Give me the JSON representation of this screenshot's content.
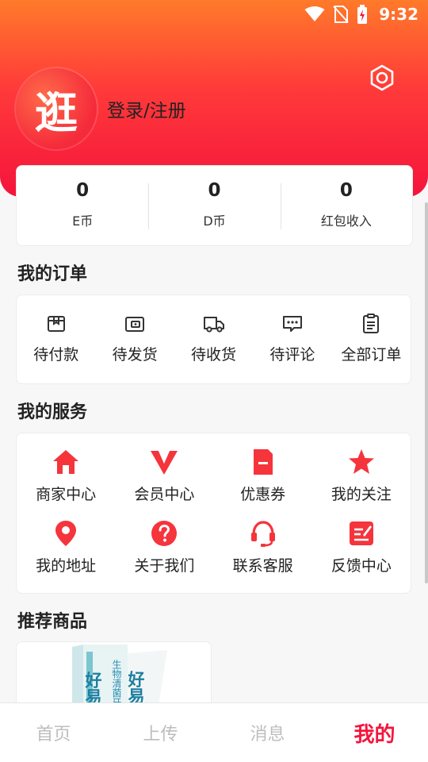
{
  "status_bar": {
    "time": "9:32"
  },
  "profile": {
    "avatar_glyph": "逛",
    "login_label": "登录/注册"
  },
  "stats": [
    {
      "value": "0",
      "label": "E币"
    },
    {
      "value": "0",
      "label": "D币"
    },
    {
      "value": "0",
      "label": "红包收入"
    }
  ],
  "orders": {
    "title": "我的订单",
    "items": [
      {
        "label": "待付款",
        "icon": "wallet-bag-icon"
      },
      {
        "label": "待发货",
        "icon": "package-box-icon"
      },
      {
        "label": "待收货",
        "icon": "delivery-truck-icon"
      },
      {
        "label": "待评论",
        "icon": "comment-bubble-icon"
      },
      {
        "label": "全部订单",
        "icon": "clipboard-list-icon"
      }
    ]
  },
  "services": {
    "title": "我的服务",
    "items": [
      {
        "label": "商家中心",
        "icon": "house-icon"
      },
      {
        "label": "会员中心",
        "icon": "v-badge-icon"
      },
      {
        "label": "优惠券",
        "icon": "coupon-icon"
      },
      {
        "label": "我的关注",
        "icon": "star-icon"
      },
      {
        "label": "我的地址",
        "icon": "location-pin-icon"
      },
      {
        "label": "关于我们",
        "icon": "question-circle-icon"
      },
      {
        "label": "联系客服",
        "icon": "headset-icon"
      },
      {
        "label": "反馈中心",
        "icon": "feedback-edit-icon"
      }
    ]
  },
  "recommended": {
    "title": "推荐商品",
    "product_image_text": {
      "brand_a": "好易康",
      "brand_b": "生物清菌牙膏"
    }
  },
  "bottom_nav": {
    "tabs": [
      {
        "label": "首页",
        "active": false
      },
      {
        "label": "上传",
        "active": false
      },
      {
        "label": "消息",
        "active": false
      },
      {
        "label": "我的",
        "active": true
      }
    ]
  },
  "colors": {
    "accent": "#f5143c",
    "header_top": "#ff7a2a",
    "inactive_tab": "#bdbdbd"
  }
}
